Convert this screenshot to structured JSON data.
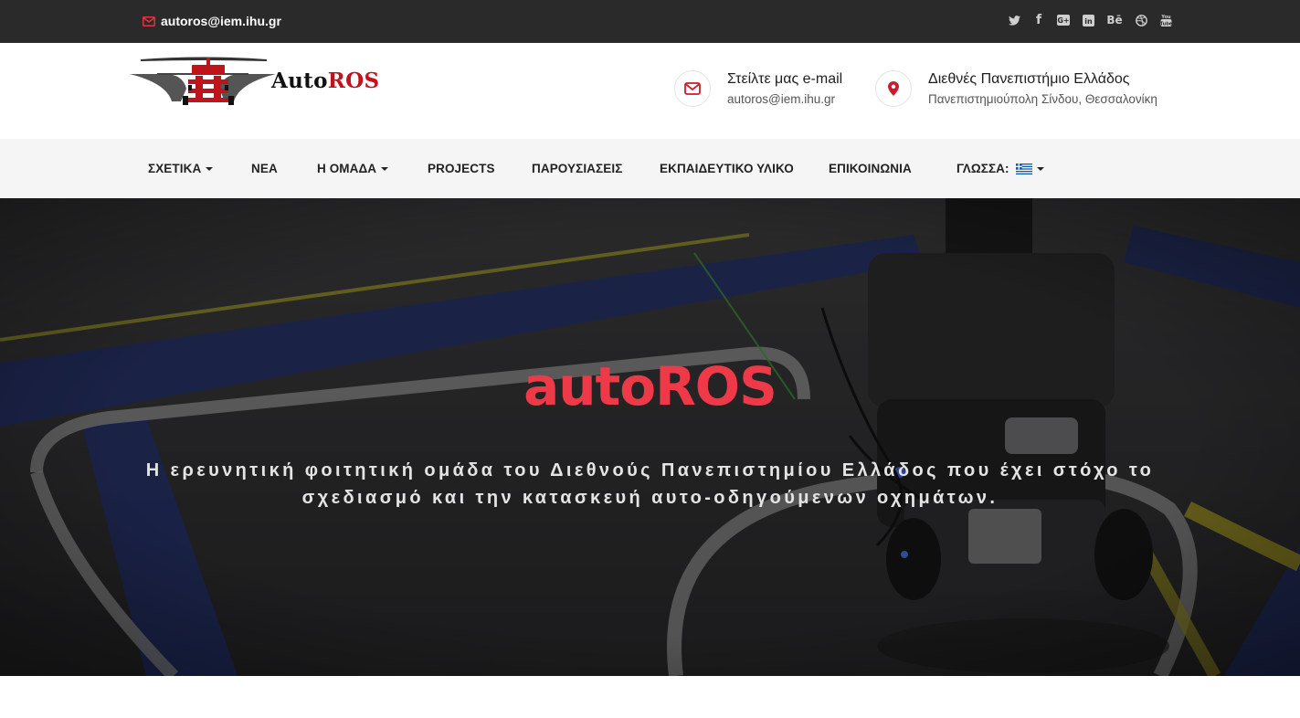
{
  "topbar": {
    "email": "autoros@iem.ihu.gr",
    "socials": [
      {
        "icon": "twitter-icon",
        "glyph": ""
      },
      {
        "icon": "facebook-icon",
        "glyph": "f"
      },
      {
        "icon": "google-plus-icon",
        "glyph": "G+"
      },
      {
        "icon": "linkedin-icon",
        "glyph": "in"
      },
      {
        "icon": "behance-icon",
        "glyph": "Bē"
      },
      {
        "icon": "dribbble-icon",
        "glyph": ""
      },
      {
        "icon": "youtube-icon",
        "glyph": ""
      }
    ]
  },
  "header": {
    "logo_text_a": "Auto",
    "logo_text_b": "ROS",
    "contact_email": {
      "title": "Στείλτε μας e-mail",
      "sub": "autoros@iem.ihu.gr"
    },
    "contact_address": {
      "title": "Διεθνές Πανεπιστήμιο Ελλάδος",
      "sub": "Πανεπιστημιούπολη Σίνδου, Θεσσαλονίκη"
    }
  },
  "nav": {
    "about": "ΣΧΕΤΙΚΑ",
    "news": "ΝΕΑ",
    "team": "Η ΟΜΑΔΑ",
    "projects": "PROJECTS",
    "presentations": "ΠΑΡΟΥΣΙΑΣΕΙΣ",
    "education": "ΕΚΠΑΙΔΕΥΤΙΚΟ ΥΛΙΚΟ",
    "contact": "ΕΠΙΚΟΙΝΩΝΙΑ",
    "language": "ΓΛΩΣΣΑ:"
  },
  "hero": {
    "title": "autoROS",
    "subtitle": "Η ερευνητική φοιτητική ομάδα του Διεθνούς Πανεπιστημίου Ελλάδος που έχει στόχο το σχεδιασμό και την κατασκευή αυτο-οδηγούμενων οχημάτων."
  },
  "colors": {
    "accent": "#c0141c",
    "hero_title": "#ee3a48",
    "topbar": "#2a2a2a"
  }
}
